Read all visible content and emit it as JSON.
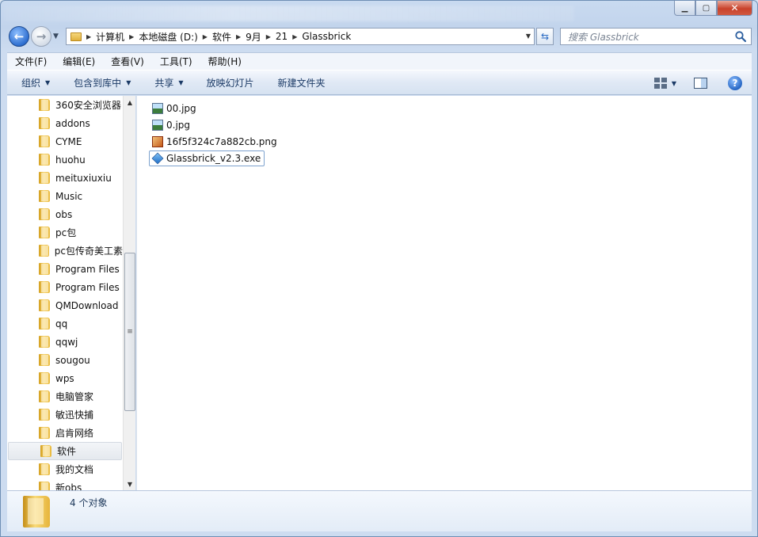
{
  "window": {
    "caption_buttons": {
      "minimize": "▁",
      "maximize": "▢",
      "close": "✕"
    }
  },
  "address": {
    "crumbs": [
      "计算机",
      "本地磁盘 (D:)",
      "软件",
      "9月",
      "21",
      "Glassbrick"
    ],
    "search_placeholder": "搜索 Glassbrick"
  },
  "menubar": [
    "文件(F)",
    "编辑(E)",
    "查看(V)",
    "工具(T)",
    "帮助(H)"
  ],
  "commandbar": {
    "organize": "组织",
    "include_in_library": "包含到库中",
    "share": "共享",
    "slideshow": "放映幻灯片",
    "new_folder": "新建文件夹"
  },
  "navigation_tree": [
    "360安全浏览器",
    "addons",
    "CYME",
    "huohu",
    "meituxiuxiu",
    "Music",
    "obs",
    "pc包",
    "pc包传奇美工素",
    "Program Files",
    "Program Files",
    "QMDownload",
    "qq",
    "qqwj",
    "sougou",
    "wps",
    "电脑管家",
    "敏迅快捕",
    "启肯网络",
    "软件",
    "我的文档",
    "新obs"
  ],
  "selected_tree_item": "软件",
  "files": [
    {
      "name": "00.jpg",
      "icon": "jpg-image-icon"
    },
    {
      "name": "0.jpg",
      "icon": "jpg-image-icon"
    },
    {
      "name": "16f5f324c7a882cb.png",
      "icon": "png-image-icon"
    },
    {
      "name": "Glassbrick_v2.3.exe",
      "icon": "exe-app-icon"
    }
  ],
  "selected_file": "Glassbrick_v2.3.exe",
  "details": {
    "count_text": "4 个对象"
  },
  "colors": {
    "accent": "#2f6fd0",
    "selection_border": "#7da2ce",
    "folder": "#f6d470"
  }
}
